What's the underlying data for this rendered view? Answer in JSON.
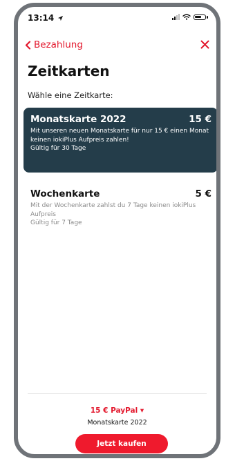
{
  "status_bar": {
    "time": "13:14",
    "icons": [
      "location-arrow-icon",
      "signal-icon",
      "wifi-icon",
      "battery-icon"
    ]
  },
  "nav": {
    "back_label": "Bezahlung",
    "close_icon": "close-icon",
    "accent_color": "#e3182d"
  },
  "page": {
    "title": "Zeitkarten",
    "section_label": "Wähle eine Zeitkarte:"
  },
  "cards": [
    {
      "title": "Monatskarte 2022",
      "price": "15 €",
      "description": "Mit unseren neuen Monatskarte für nur 15 € einen Monat keinen iokiPlus Aufpreis zahlen!",
      "validity": "Gültig für 30 Tage",
      "selected": true,
      "background": "#243d4a"
    },
    {
      "title": "Wochenkarte",
      "price": "5 €",
      "description": "Mit der Wochenkarte zahlst du 7 Tage keinen iokiPlus Aufpreis",
      "validity": "Gültig für 7 Tage",
      "selected": false
    }
  ],
  "footer": {
    "payment": "15 € PayPal ▾",
    "selected_product": "Monatskarte 2022",
    "buy_label": "Jetzt kaufen",
    "button_color": "#ef1a2d"
  }
}
